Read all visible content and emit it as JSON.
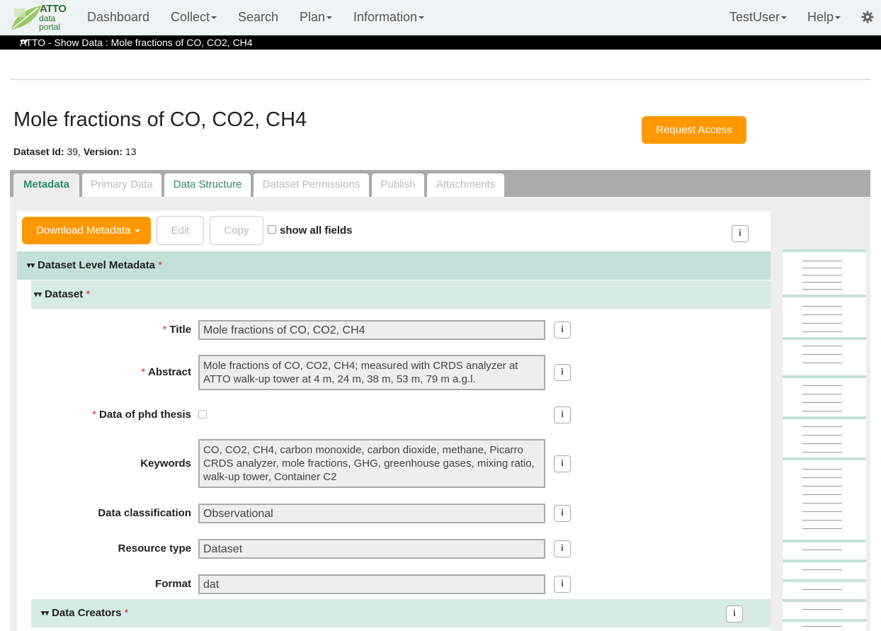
{
  "brand": {
    "name": "ATTO",
    "line2": "data",
    "line3": "portal"
  },
  "nav": {
    "items": [
      {
        "label": "Dashboard",
        "dropdown": false
      },
      {
        "label": "Collect",
        "dropdown": true
      },
      {
        "label": "Search",
        "dropdown": false
      },
      {
        "label": "Plan",
        "dropdown": true
      },
      {
        "label": "Information",
        "dropdown": true
      }
    ],
    "user": "TestUser",
    "help": "Help",
    "gear_icon": "gear-icon"
  },
  "breadcrumb": "ATTO - Show Data : Mole fractions of CO, CO2, CH4",
  "dataset": {
    "title": "Mole fractions of CO, CO2, CH4",
    "id_label": "Dataset Id:",
    "id_value": "39",
    "version_label": "Version:",
    "version_value": "13",
    "request_access": "Request Access"
  },
  "tabs": [
    "Metadata",
    "Primary Data",
    "Data Structure",
    "Dataset Permissions",
    "Publish",
    "Attachments"
  ],
  "toolbar": {
    "download": "Download Metadata",
    "edit": "Edit",
    "copy": "Copy",
    "show_all": "show all fields"
  },
  "sections": {
    "level": "Dataset Level Metadata",
    "dataset": "Dataset",
    "creators": "Data Creators",
    "required_mark": "*"
  },
  "fields": {
    "title": {
      "label": "Title",
      "value": "Mole fractions of CO, CO2, CH4"
    },
    "abstract": {
      "label": "Abstract",
      "value": "Mole fractions of CO, CO2, CH4; measured with CRDS analyzer at ATTO walk-up tower at 4 m, 24 m, 38 m, 53 m, 79 m a.g.l."
    },
    "phd": {
      "label": "Data of phd thesis"
    },
    "keywords": {
      "label": "Keywords",
      "value": "CO, CO2, CH4, carbon monoxide, carbon dioxide, methane, Picarro CRDS analyzer, mole fractions, GHG, greenhouse gases, mixing ratio, walk-up tower, Container C2"
    },
    "classification": {
      "label": "Data classification",
      "value": "Observational"
    },
    "resource_type": {
      "label": "Resource type",
      "value": "Dataset"
    },
    "format": {
      "label": "Format",
      "value": "dat"
    }
  },
  "info_glyph": "i",
  "colors": {
    "accent_orange": "#ff9800",
    "tab_green": "#2e8a6e",
    "section_green": "#c3e1d9"
  }
}
